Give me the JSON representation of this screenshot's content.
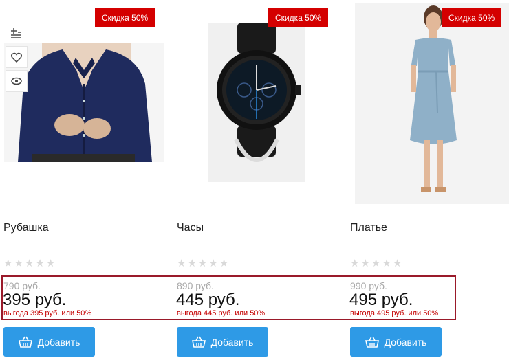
{
  "products": [
    {
      "badge": "Скидка 50%",
      "title": "Рубашка",
      "rating": 0,
      "old_price": "790 руб.",
      "price": "395 руб.",
      "profit": "выгода 395 руб. или 50%",
      "add_label": "Добавить"
    },
    {
      "badge": "Скидка 50%",
      "title": "Часы",
      "rating": 0,
      "old_price": "890 руб.",
      "price": "445 руб.",
      "profit": "выгода 445 руб. или 50%",
      "add_label": "Добавить"
    },
    {
      "badge": "Скидка 50%",
      "title": "Платье",
      "rating": 0,
      "old_price": "990 руб.",
      "price": "495 руб.",
      "profit": "выгода 495 руб. или 50%",
      "add_label": "Добавить"
    }
  ],
  "icons": {
    "compare": "compare-icon",
    "wishlist": "heart-icon",
    "quick_view": "eye-icon",
    "basket": "basket-icon"
  },
  "colors": {
    "badge": "#d40000",
    "button": "#2e9ae6",
    "profit_text": "#c40000",
    "highlight_frame": "#9a1a2a"
  }
}
